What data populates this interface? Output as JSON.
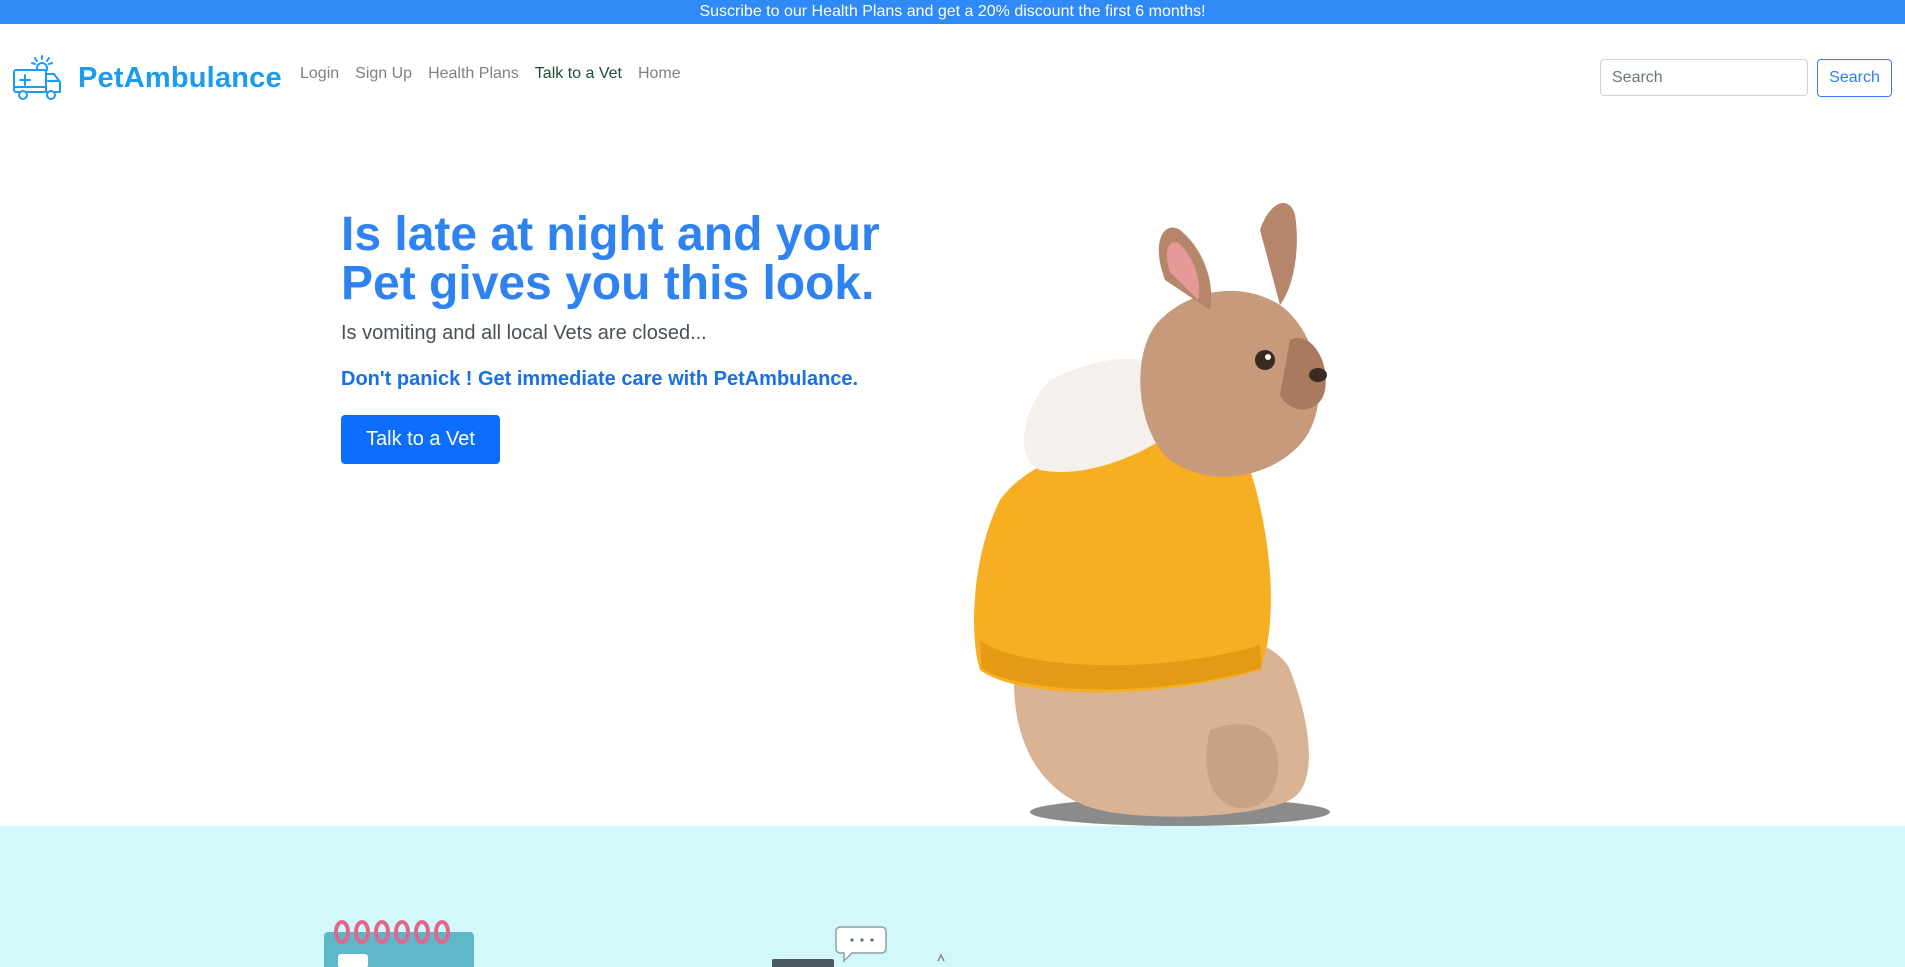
{
  "promo_banner": {
    "text": "Suscribe to our Health Plans and get a 20% discount the first 6 months!"
  },
  "navbar": {
    "brand_name": "PetAmbulance",
    "brand_icon": "ambulance-icon",
    "links": [
      {
        "label": "Login",
        "active": false
      },
      {
        "label": "Sign Up",
        "active": false
      },
      {
        "label": "Health Plans",
        "active": false
      },
      {
        "label": "Talk to a Vet",
        "active": true
      },
      {
        "label": "Home",
        "active": false
      }
    ],
    "search_placeholder": "Search",
    "search_button_label": "Search"
  },
  "hero": {
    "title": "Is late at night and your Pet gives you this look.",
    "subtitle": "Is vomiting and all local Vets are closed...",
    "cta_text": "Don't panick ! Get immediate care with PetAmbulance.",
    "button_label": "Talk to a Vet"
  },
  "colors": {
    "promo_bar": "#2f8af5",
    "brand": "#1b9cf0",
    "hero_title": "#2f83f0",
    "primary_button": "#0d6efd",
    "lower_band": "#d3f8fb",
    "dog_hoodie": "#f6ae22"
  }
}
